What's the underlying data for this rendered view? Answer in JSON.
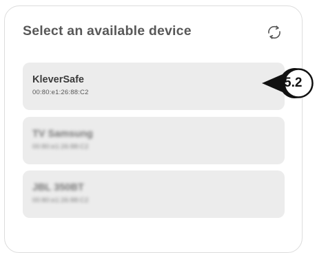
{
  "header": {
    "title": "Select an available device",
    "refresh_icon": "refresh-icon"
  },
  "devices": [
    {
      "name": "KleverSafe",
      "mac": "00:80:e1:26:88:C2"
    },
    {
      "name": "TV Samsung",
      "mac": "00:80:e1:26:88:C2"
    },
    {
      "name": "JBL 350BT",
      "mac": "00:80:e1:26:88:C2"
    }
  ],
  "callout": {
    "label": "5.2"
  }
}
